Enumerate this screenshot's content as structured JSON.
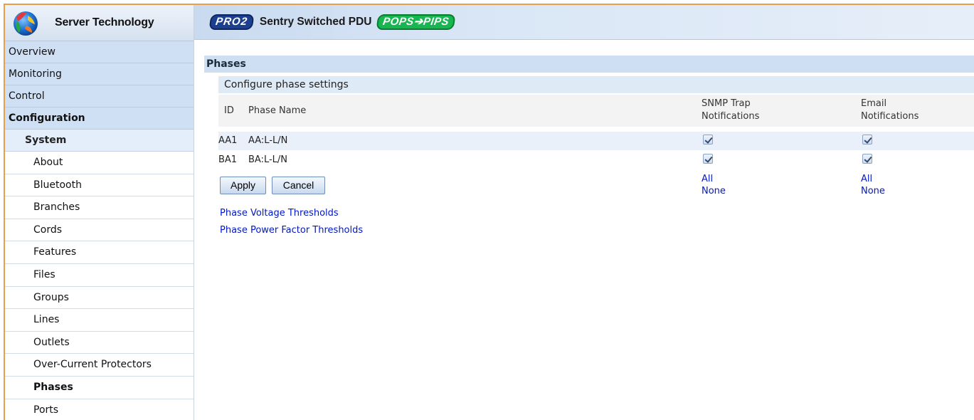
{
  "brand": {
    "name": "Server Technology"
  },
  "header": {
    "pro_badge": "PRO2",
    "title": "Sentry Switched PDU",
    "pops_badge": "POPS➔PIPS"
  },
  "sidebar": {
    "top_items": [
      "Overview",
      "Monitoring",
      "Control",
      "Configuration"
    ],
    "system_label": "System",
    "sub_items": [
      "About",
      "Bluetooth",
      "Branches",
      "Cords",
      "Features",
      "Files",
      "Groups",
      "Lines",
      "Outlets",
      "Over-Current Protectors",
      "Phases",
      "Ports"
    ]
  },
  "main": {
    "section_title": "Phases",
    "subtitle": "Configure phase settings",
    "columns": {
      "id": "ID",
      "name": "Phase Name",
      "snmp_line1": "SNMP Trap",
      "snmp_line2": "Notifications",
      "email_line1": "Email",
      "email_line2": "Notifications"
    },
    "rows": [
      {
        "id": "AA1",
        "name": "AA:L-L/N",
        "snmp": true,
        "email": true
      },
      {
        "id": "BA1",
        "name": "BA:L-L/N",
        "snmp": true,
        "email": true
      }
    ],
    "buttons": {
      "apply": "Apply",
      "cancel": "Cancel"
    },
    "select": {
      "all": "All",
      "none": "None"
    },
    "links": {
      "voltage": "Phase Voltage Thresholds",
      "power_factor": "Phase Power Factor Thresholds"
    }
  }
}
